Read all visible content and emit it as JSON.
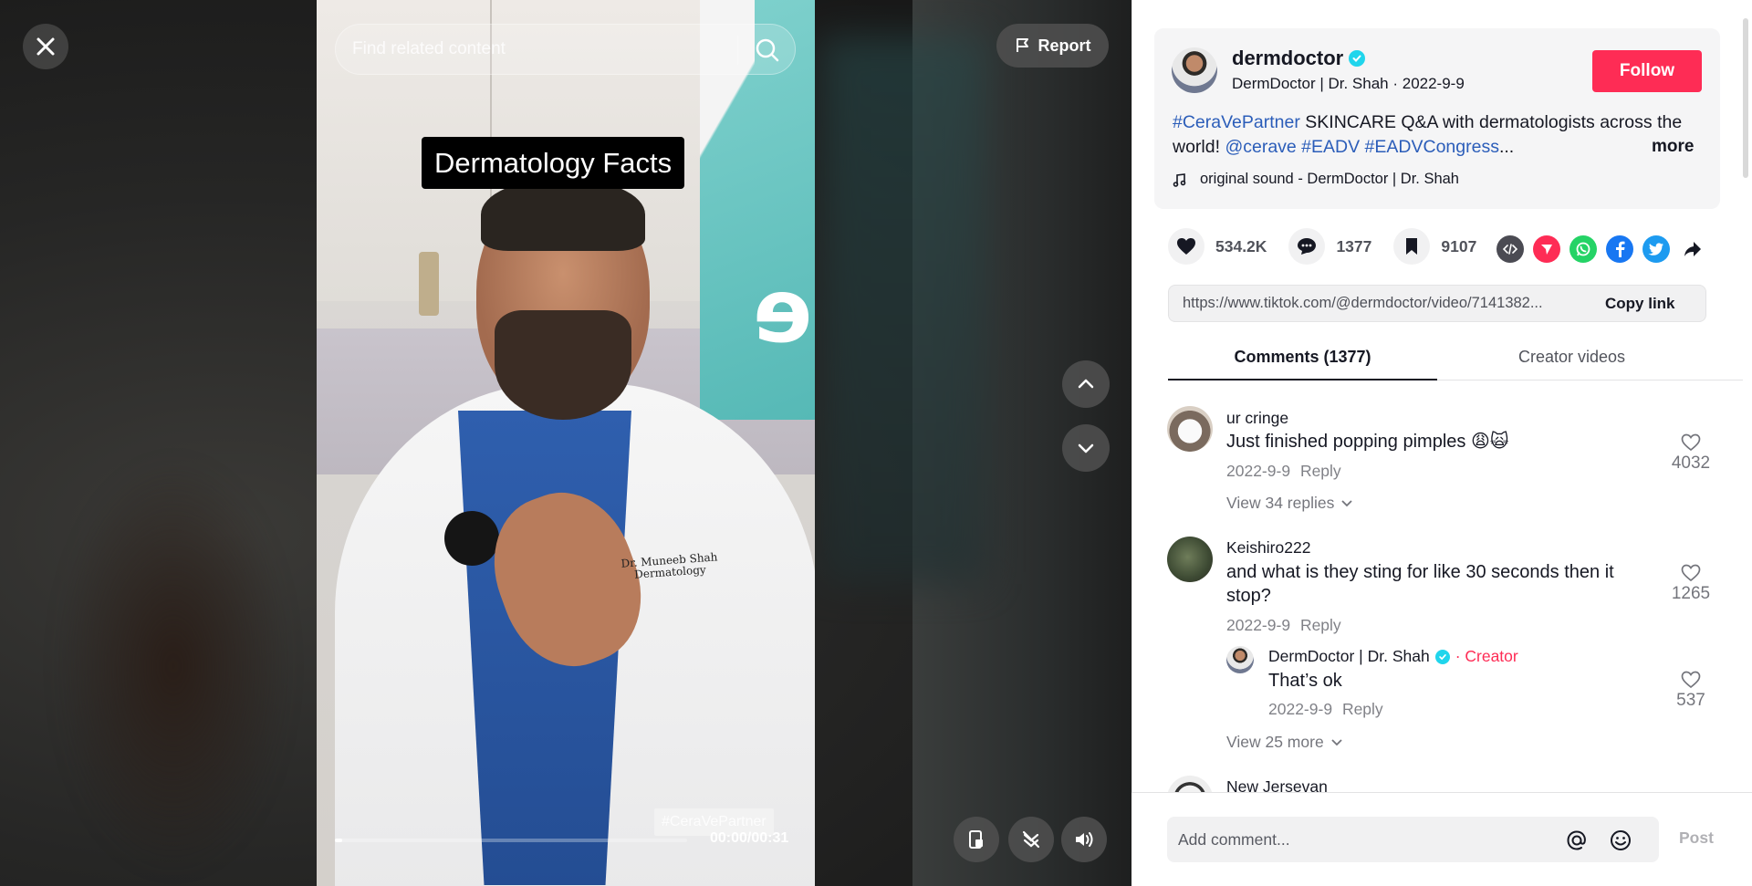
{
  "player": {
    "search_placeholder": "Find related content",
    "report_label": "Report",
    "overlay_title": "Dermatology Facts",
    "hashtag_watermark": "#CeraVePartner",
    "coat_name": "Dr. Muneeb Shah",
    "coat_dept": "Dermatology",
    "time": "00:00/00:31",
    "progress_fraction": 0.02,
    "icons": [
      "close-icon",
      "search-icon",
      "flag-icon",
      "chevron-up-icon",
      "chevron-down-icon",
      "floating-player-icon",
      "auto-scroll-icon",
      "volume-icon"
    ]
  },
  "post": {
    "username": "dermdoctor",
    "subtitle": "DermDoctor | Dr. Shah · 2022-9-9",
    "follow_label": "Follow",
    "desc_tag1": "#CeraVePartner",
    "desc_text1": " SKINCARE Q&A with dermatologists across the world! ",
    "desc_tag2": "@cerave #EADV #EADVCongress",
    "desc_ellipsis": "...",
    "more_label": "more",
    "sound": "original sound - DermDoctor | Dr. Shah",
    "likes": "534.2K",
    "comments": "1377",
    "saves": "9107",
    "link": "https://www.tiktok.com/@dermdoctor/video/7141382...",
    "copy_label": "Copy link",
    "share_colors": {
      "embed": "#4b4b53",
      "send": "#fe2c55",
      "whatsapp": "#25d366",
      "facebook": "#1877f2",
      "twitter": "#1d9bf0"
    }
  },
  "tabs": {
    "comments": "Comments (1377)",
    "creator": "Creator videos"
  },
  "comments": [
    {
      "user": "ur cringe",
      "text": "Just finished popping pimples 😩🙀",
      "date": "2022-9-9",
      "reply": "Reply",
      "likes": "4032",
      "view_replies": "View 34 replies"
    },
    {
      "user": "Keishiro222",
      "text": "and what is they sting for like 30 seconds then it stop?",
      "date": "2022-9-9",
      "reply": "Reply",
      "likes": "1265",
      "sub": {
        "user": "DermDoctor | Dr. Shah",
        "badge": "· Creator",
        "text": "That’s ok",
        "date": "2022-9-9",
        "reply": "Reply",
        "likes": "537"
      },
      "view_more": "View 25 more"
    },
    {
      "user": "New Jersevan"
    }
  ],
  "composer": {
    "placeholder": "Add comment...",
    "post_label": "Post"
  },
  "accent": "#fe2c55"
}
